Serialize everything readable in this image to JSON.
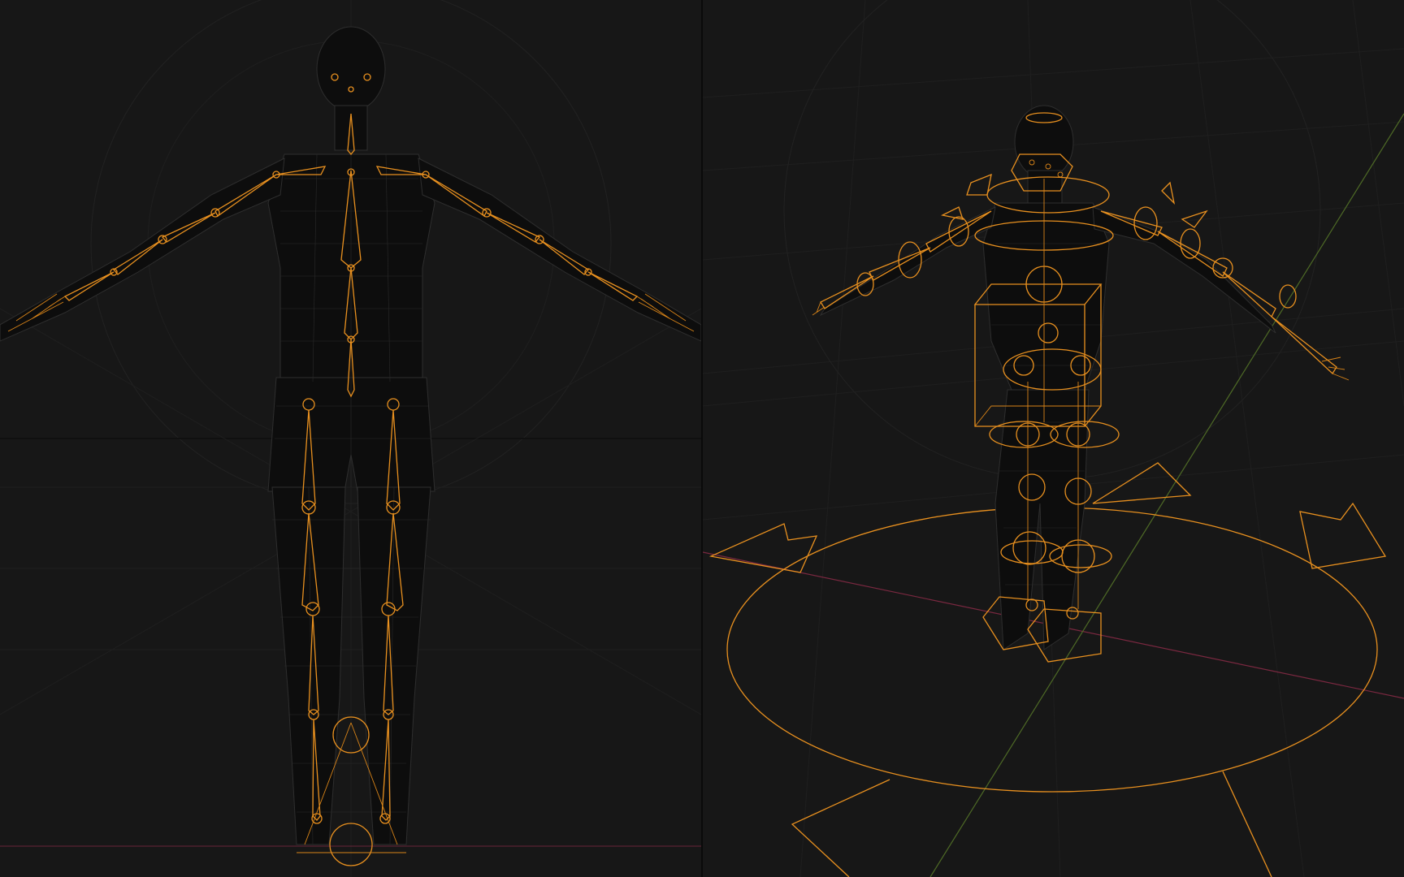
{
  "viewports": {
    "front": {
      "name": "front-orthographic-viewport"
    },
    "perspective": {
      "name": "perspective-viewport"
    }
  },
  "colors": {
    "background": "#171717",
    "rig_orange": "#e8901f",
    "mesh_wire": "#2e2e2e",
    "axis_x": "#8a2f45",
    "axis_y": "#5a7a2a"
  }
}
